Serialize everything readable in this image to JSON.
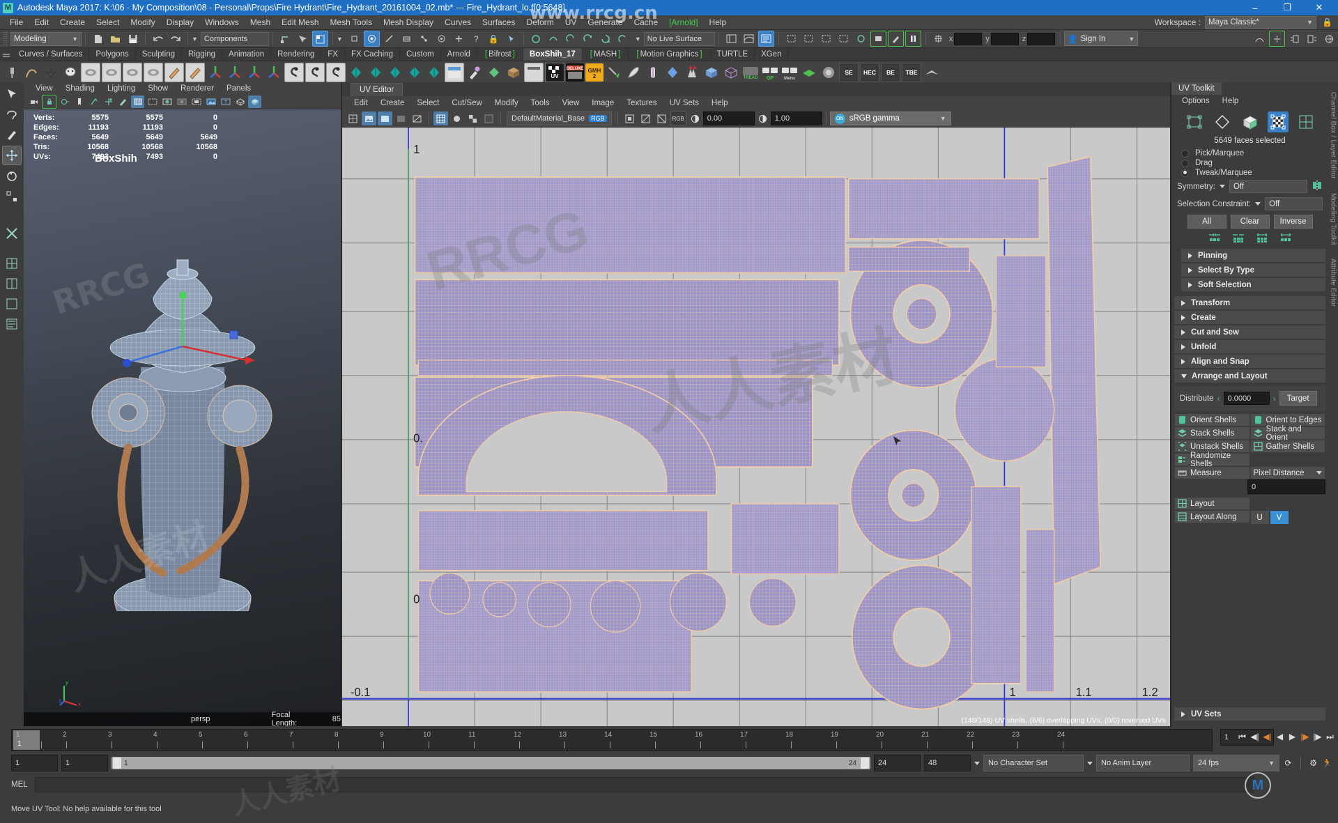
{
  "window": {
    "title": "Autodesk Maya 2017: K:\\06 - My Composition\\08 - Personal\\Props\\Fire Hydrant\\Fire_Hydrant_20161004_02.mb*  ---  Fire_Hydrant_lo.f[0:5648]",
    "app_icon": "M",
    "minimize": "–",
    "maximize": "❐",
    "close": "✕"
  },
  "menubar": {
    "items": [
      "File",
      "Edit",
      "Create",
      "Select",
      "Modify",
      "Display",
      "Windows",
      "Mesh",
      "Edit Mesh",
      "Mesh Tools",
      "Mesh Display",
      "Curves",
      "Surfaces",
      "Deform",
      "UV",
      "Generate",
      "Cache",
      "Arnold",
      "Help"
    ],
    "highlighted": "Arnold",
    "workspace_label": "Workspace :",
    "workspace_value": "Maya Classic*",
    "lock_icon": "lock-icon"
  },
  "statusline": {
    "mode": "Modeling",
    "components": "Components",
    "no_live_surface": "No Live Surface",
    "coord_x": "x",
    "coord_y": "y",
    "coord_z": "z",
    "coord_x_value": "",
    "coord_y_value": "",
    "coord_z_value": "",
    "signin": "Sign In"
  },
  "shelf": {
    "tabs": [
      {
        "label": "Curves / Surfaces",
        "active": false,
        "bracket": false
      },
      {
        "label": "Polygons",
        "active": false,
        "bracket": false
      },
      {
        "label": "Sculpting",
        "active": false,
        "bracket": false
      },
      {
        "label": "Rigging",
        "active": false,
        "bracket": false
      },
      {
        "label": "Animation",
        "active": false,
        "bracket": false
      },
      {
        "label": "Rendering",
        "active": false,
        "bracket": false
      },
      {
        "label": "FX",
        "active": false,
        "bracket": false
      },
      {
        "label": "FX Caching",
        "active": false,
        "bracket": false
      },
      {
        "label": "Custom",
        "active": false,
        "bracket": false
      },
      {
        "label": "Arnold",
        "active": false,
        "bracket": false
      },
      {
        "label": "Bifrost",
        "active": false,
        "bracket": true
      },
      {
        "label": "BoxShih_17",
        "active": true,
        "bracket": false
      },
      {
        "label": "MASH",
        "active": false,
        "bracket": true
      },
      {
        "label": "Motion Graphics",
        "active": false,
        "bracket": true
      },
      {
        "label": "TURTLE",
        "active": false,
        "bracket": false
      },
      {
        "label": "XGen",
        "active": false,
        "bracket": false
      }
    ],
    "icons": [
      "All",
      "FN",
      "VN",
      "NS",
      "Hist",
      "HistA",
      "RT",
      "FT",
      "CP",
      "FIL",
      "MP",
      "PN",
      "RLink",
      "UVHE",
      "PTOP",
      "PIX",
      "DAP",
      "Text",
      "TM",
      "UV",
      "GMH2",
      "Menu",
      "SE",
      "HEC",
      "BE",
      "TBE"
    ]
  },
  "persp_viewport": {
    "menus": [
      "View",
      "Shading",
      "Lighting",
      "Show",
      "Renderer",
      "Panels"
    ],
    "hud": {
      "rows": [
        {
          "label": "Verts:",
          "total": "5575",
          "b": "5575",
          "c": "0"
        },
        {
          "label": "Edges:",
          "total": "11193",
          "b": "11193",
          "c": "0"
        },
        {
          "label": "Faces:",
          "total": "5649",
          "b": "5649",
          "c": "5649"
        },
        {
          "label": "Tris:",
          "total": "10568",
          "b": "10568",
          "c": "10568"
        },
        {
          "label": "UVs:",
          "total": "7493",
          "b": "7493",
          "c": "0"
        }
      ]
    },
    "object_name": "BoxShih",
    "camera": "persp",
    "focal_label": "Focal Length:",
    "focal_value": "85",
    "axis": {
      "x": "x",
      "y": "y",
      "z": "z"
    }
  },
  "uv_editor": {
    "tab": "UV Editor",
    "menus": [
      "Edit",
      "Create",
      "Select",
      "Cut/Sew",
      "Modify",
      "Tools",
      "View",
      "Image",
      "Textures",
      "UV Sets",
      "Help"
    ],
    "material": "DefaultMaterial_Base",
    "material_badge": "RGB",
    "exposure_value": "0.00",
    "gamma_value": "1.00",
    "color_space": "sRGB gamma",
    "color_space_toggle": "ON",
    "status": "(148/148) UV shells, (6/6) overlapping UVs, (0/0) reversed UVs",
    "axis_labels_x": [
      "-0.1",
      "0",
      "1",
      "1.1",
      "1.2"
    ],
    "axis_labels_y": [
      "1",
      "0.",
      "0"
    ]
  },
  "uv_toolkit": {
    "tab": "UV Toolkit",
    "menus": [
      "Options",
      "Help"
    ],
    "selection_modes": [
      "uv-mode-icon",
      "vertex-mode-icon",
      "edge-mode-icon",
      "face-mode-icon",
      "shell-mode-icon"
    ],
    "active_mode_index": 3,
    "selection_text": "5649 faces selected",
    "radios": [
      {
        "label": "Pick/Marquee",
        "selected": false
      },
      {
        "label": "Drag",
        "selected": false
      },
      {
        "label": "Tweak/Marquee",
        "selected": true
      }
    ],
    "symmetry_label": "Symmetry:",
    "symmetry_value": "Off",
    "constraint_label": "Selection Constraint:",
    "constraint_value": "Off",
    "sel_buttons": [
      "All",
      "Clear",
      "Inverse"
    ],
    "sections": [
      {
        "label": "Pinning",
        "open": false,
        "sub": true
      },
      {
        "label": "Select By Type",
        "open": false,
        "sub": true
      },
      {
        "label": "Soft Selection",
        "open": false,
        "sub": true
      },
      {
        "label": "Transform",
        "open": false,
        "sub": false
      },
      {
        "label": "Create",
        "open": false,
        "sub": false
      },
      {
        "label": "Cut and Sew",
        "open": false,
        "sub": false
      },
      {
        "label": "Unfold",
        "open": false,
        "sub": false
      },
      {
        "label": "Align and Snap",
        "open": false,
        "sub": false
      },
      {
        "label": "Arrange and Layout",
        "open": true,
        "sub": false
      }
    ],
    "distribute_label": "Distribute",
    "distribute_value": "0.0000",
    "target_button": "Target",
    "shell_buttons": [
      "Orient Shells",
      "Orient to Edges",
      "Stack Shells",
      "Stack and Orient",
      "Unstack Shells",
      "Gather Shells",
      "Randomize Shells"
    ],
    "measure_label": "Measure",
    "measure_mode": "Pixel Distance",
    "measure_value": "0",
    "layout_label": "Layout",
    "layout_along_label": "Layout Along",
    "layout_u": "U",
    "layout_v": "V",
    "uv_sets_section": "UV Sets",
    "side_tabs": [
      "Channel Box / Layer Editor",
      "Modeling Toolkit",
      "Attribute Editor"
    ]
  },
  "timeline": {
    "ticks": [
      "1",
      "2",
      "3",
      "4",
      "5",
      "6",
      "7",
      "8",
      "9",
      "10",
      "11",
      "12",
      "13",
      "14",
      "15",
      "16",
      "17",
      "18",
      "19",
      "20",
      "21",
      "22",
      "23",
      "24"
    ],
    "current_frame": "1",
    "playhead_label": "1",
    "range_start": "1",
    "range_end": "1",
    "slider_start": "1",
    "slider_end": "24",
    "anim_start": "24",
    "anim_end": "48",
    "character_set": "No Character Set",
    "anim_layer": "No Anim Layer",
    "fps": "24 fps",
    "transport_icons": [
      "go-to-start-icon",
      "step-back-key-icon",
      "step-back-frame-icon",
      "play-backwards-icon",
      "play-forwards-icon",
      "step-forward-frame-icon",
      "step-forward-key-icon",
      "go-to-end-icon"
    ]
  },
  "command_line": {
    "label": "MEL",
    "value": "",
    "help_text": "Move UV Tool: No help available for this tool"
  },
  "watermarks": {
    "site": "www.rrcg.cn",
    "mark1": "RRCG",
    "mark2": "人人素材"
  },
  "colors": {
    "accent_blue": "#1f6fc4",
    "panel_bg": "#3c3c3c",
    "toolbar_bg": "#444444",
    "green": "#49b99a",
    "uv_shell_fill": "#9a94c8",
    "uv_shell_edge": "#f4c9a0",
    "uv_bg": "#c9c9c9"
  }
}
